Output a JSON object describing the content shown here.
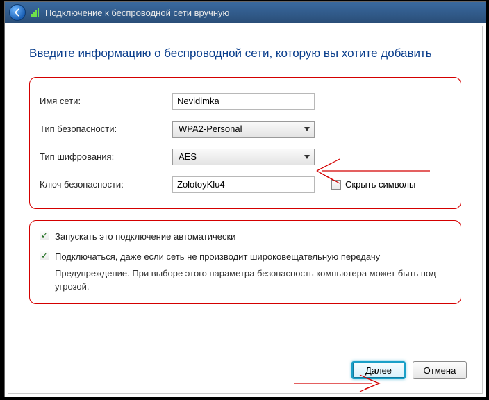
{
  "window": {
    "title": "Подключение к беспроводной сети вручную"
  },
  "heading": "Введите информацию о беспроводной сети, которую вы хотите добавить",
  "form": {
    "ssid_label": "Имя сети:",
    "ssid_value": "Nevidimka",
    "sectype_label": "Тип безопасности:",
    "sectype_value": "WPA2-Personal",
    "enctype_label": "Тип шифрования:",
    "enctype_value": "AES",
    "key_label": "Ключ безопасности:",
    "key_value": "ZolotoyKlu4",
    "hide_label": "Скрыть символы"
  },
  "options": {
    "auto_label": "Запускать это подключение автоматически",
    "hidden_label": "Подключаться, даже если сеть не производит широковещательную передачу",
    "warning": "Предупреждение. При выборе этого параметра безопасность компьютера может быть под угрозой."
  },
  "buttons": {
    "next": "Далее",
    "cancel": "Отмена"
  }
}
